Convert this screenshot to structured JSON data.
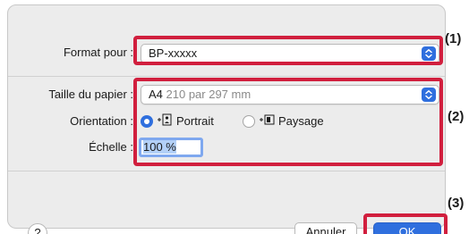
{
  "dialog": {
    "format": {
      "label": "Format pour :",
      "value": "BP-xxxxx"
    },
    "paper": {
      "label": "Taille du papier :",
      "size": "A4",
      "dims": "210 par 297 mm"
    },
    "orientation": {
      "label": "Orientation :",
      "portrait": "Portrait",
      "landscape": "Paysage",
      "selected": "portrait"
    },
    "scale": {
      "label": "Échelle :",
      "value": "100 %"
    },
    "footer": {
      "help": "?",
      "cancel": "Annuler",
      "ok": "OK"
    }
  },
  "callouts": {
    "one": "(1)",
    "two": "(2)",
    "three": "(3)"
  },
  "colors": {
    "accent": "#2f6fde",
    "callout": "#d11f3e",
    "dialog_bg": "#ececec"
  }
}
